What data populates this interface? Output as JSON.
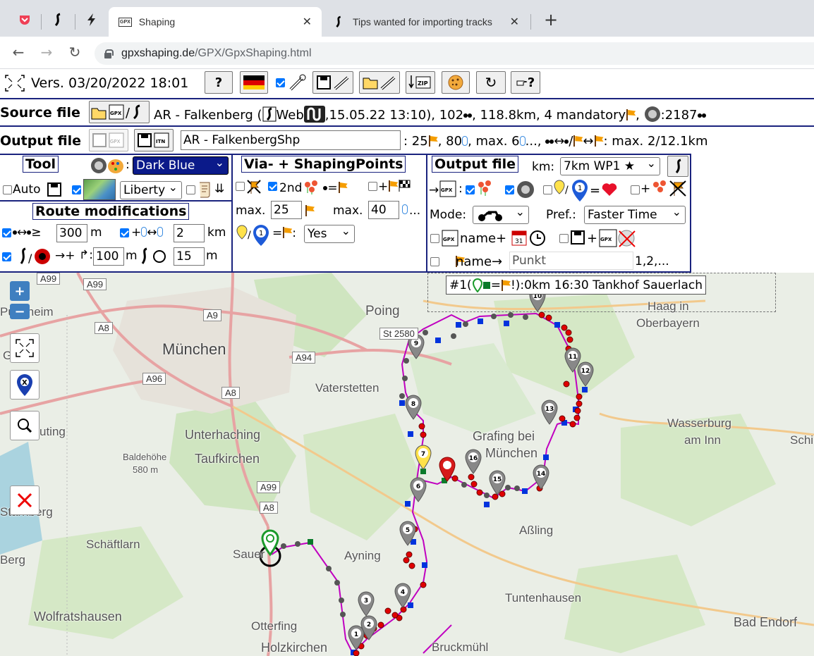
{
  "browser": {
    "tabs": [
      {
        "title": "Shaping",
        "active": true
      },
      {
        "title": "Tips wanted for importing tracks",
        "active": false
      }
    ],
    "new_tab": "+",
    "tab_close": "✕",
    "url_domain": "gpxshaping.de",
    "url_path": "/GPX/GpxShaping.html"
  },
  "toolbar": {
    "version": "Vers. 03/20/2022 18:01",
    "help_label": "?",
    "undo_label": "↻",
    "key_label": "?"
  },
  "source": {
    "label": "Source file",
    "text_a": "AR - Falkenberg (",
    "text_web": "Web",
    "text_b": ",15.05.22 13:10), 102",
    "text_c": ", 118.8km, 4 mandatory",
    "text_d": ", ",
    "text_e": ":2187"
  },
  "output": {
    "label": "Output file",
    "filename": "AR - FalkenbergShp",
    "text_a": ": 25",
    "text_b": ", 80",
    "text_c": ", max. 6",
    "text_d": "..., ",
    "text_e": "↔",
    "text_f": "/",
    "text_g": "↔",
    "text_h": ": max. 2/12.1km"
  },
  "tool": {
    "title": "Tool",
    "colon": ":",
    "color_select": "Dark Blue",
    "auto_label": "Auto",
    "map_style_select": "Liberty",
    "arrows": "⇊"
  },
  "route_mod": {
    "title": "Route modifications",
    "row1_sym": "↔",
    "row1_ge": "≥",
    "row1_value": "300",
    "row1_unit": "m",
    "row1b_sym": "+",
    "row1b_value": "2",
    "row1b_unit": "km",
    "row2_arrow": "→+",
    "row2_value": "100",
    "row2_unit": "m",
    "row2b_value": "15",
    "row2b_unit": "m"
  },
  "via": {
    "title": "Via- + ShapingPoints",
    "second_label": "2nd",
    "eq": "=",
    "plus": "+",
    "max_label1": "max.",
    "max_value1": "25",
    "max_label2": "max.",
    "max_value2": "40",
    "ellipsis": "...",
    "yes_select": "Yes"
  },
  "outfile": {
    "title": "Output file",
    "km_label": "km:",
    "km_select": "7km WP1 ★",
    "arrow": "→",
    "mode_label": "Mode:",
    "pref_label": "Pref.:",
    "pref_select": "Faster Time",
    "name_plus": "name+",
    "name_arrow": "name→",
    "name_placeholder": "Punkt",
    "name_suffix": "1,2,..."
  },
  "map": {
    "infobox": "#1(",
    "infobox_b": "=",
    "infobox_c": "!):0km 16:30 Tankhof Sauerlach",
    "places": [
      "München",
      "Poing",
      "Vaterstetten",
      "Haag in",
      "Oberbayern",
      "Wasserburg",
      "am Inn",
      "Unterhaching",
      "Taufkirchen",
      "Grafing bei",
      "München",
      "Baldehöhe",
      "580 m",
      "Schäftlarn",
      "Aßling",
      "Tuntenhausen",
      "Bad Endorf",
      "Wolfratshausen",
      "Otterfing",
      "Holzkirchen",
      "Bruckmühl",
      "Ayning",
      "Sauer",
      "Berg",
      "Puchheim",
      "Gering",
      "uting",
      "Starnberg",
      "Schi"
    ],
    "roads": [
      "A99",
      "A9",
      "A8",
      "A96",
      "A94",
      "A8",
      "A99",
      "A8",
      "St 2580"
    ],
    "numbered_markers": [
      "1",
      "2",
      "3",
      "4",
      "5",
      "6",
      "7",
      "8",
      "9",
      "10",
      "11",
      "12",
      "13",
      "14",
      "15",
      "16"
    ],
    "zoom_in": "+",
    "zoom_out": "−"
  },
  "colors": {
    "route": "#c000c0",
    "panel_border": "#1a237e",
    "accent": "#0075ff"
  }
}
